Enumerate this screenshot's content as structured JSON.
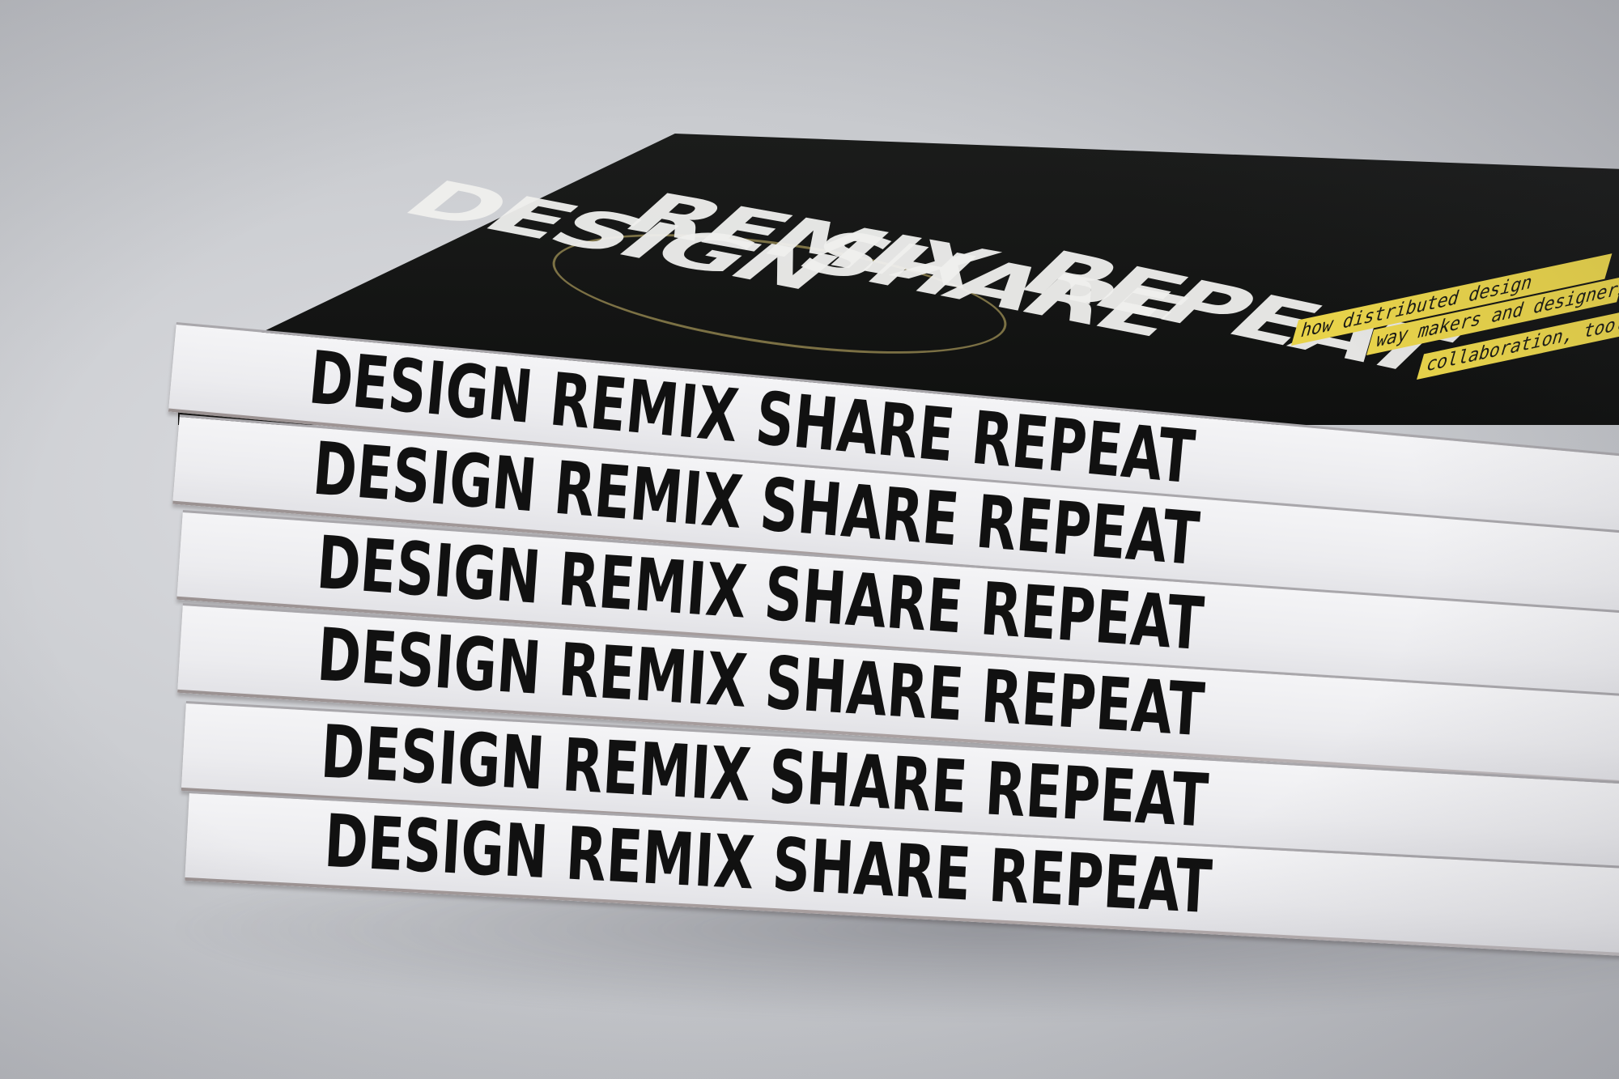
{
  "scene": {
    "description_label": "",
    "background_color": "#c9cbcf",
    "spine_color": "#f0f0f2",
    "cover_color": "#131413",
    "accent_color": "#e8d34a"
  },
  "cover": {
    "title_lines": [
      "DESIGN",
      "REMIX",
      "SHARE",
      "REPEAT"
    ],
    "tagline_lines": [
      "how distributed design",
      "way makers and designers",
      "collaboration, tools and"
    ]
  },
  "spines": [
    {
      "text": "DESIGN REMIX SHARE REPEAT"
    },
    {
      "text": "DESIGN REMIX SHARE REPEAT"
    },
    {
      "text": "DESIGN REMIX SHARE REPEAT"
    },
    {
      "text": "DESIGN REMIX SHARE REPEAT"
    },
    {
      "text": "DESIGN REMIX SHARE REPEAT"
    },
    {
      "text": "DESIGN REMIX SHARE REPEAT"
    }
  ]
}
